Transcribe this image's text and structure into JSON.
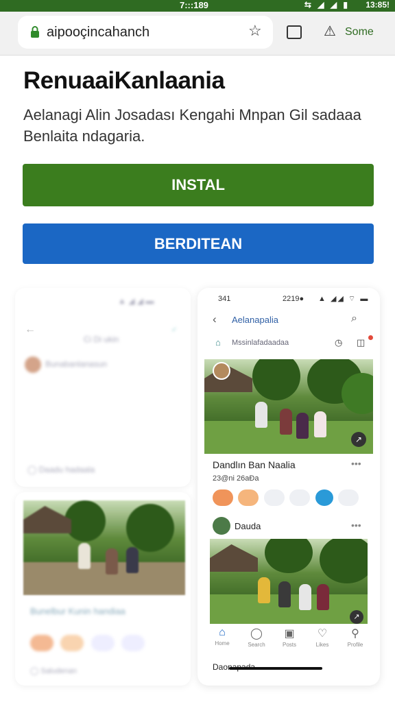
{
  "status_bar": {
    "time": "7:::189",
    "clock2": "13:85!",
    "icons": "⇆ ◢ ◢ ▮"
  },
  "browser": {
    "url": "aipooçincahanch",
    "lock_icon": "lock-icon",
    "bookmark_icon": "star-icon",
    "tab_icon": "tab-icon",
    "warn_icon": "warning-icon",
    "extra_label": "Some"
  },
  "page": {
    "title": "RenuaaiKanlaania",
    "description": "Aelanagi Alin Josadası Kengahi Mnpan Gil sadaaa Benlaita ndagaria."
  },
  "buttons": {
    "install_label": "INSTAL",
    "share_label": "BERDITEAN"
  },
  "left_phone": {
    "status": "▲ ◢ ◢ ▬",
    "back": "←",
    "title": "Ci  Di  ukin",
    "tag": "✓",
    "name": "Bunabanlanasun",
    "foot": "◯  Daadu hadaala"
  },
  "left_card2": {
    "title": "Bunelbur Kunin handiaa",
    "foot": "◯  Saludenan"
  },
  "right_phone": {
    "status_left": "341",
    "status_mid": "2219●",
    "status_icons": "▲ ◢◢ ⌔ ▬",
    "back": "‹",
    "title": "Aelanapalia",
    "search_icon": "⌕",
    "search_text": "Mssinlafadaadaa",
    "post_title": "Dandlın Ban Naalia",
    "post_meta": "23@ni 26aĐa",
    "user_name": "Dauda",
    "nav": [
      "Home",
      "Search",
      "Posts",
      "Likes",
      "Profile"
    ],
    "bottom_text": "Daonapada"
  },
  "colors": {
    "status_bg": "#2f6b22",
    "install": "#3b7d1e",
    "share": "#1b67c4",
    "reaction_1": "#f0945a",
    "reaction_2": "#f5b57c",
    "reaction_blue": "#2a9ad8"
  }
}
